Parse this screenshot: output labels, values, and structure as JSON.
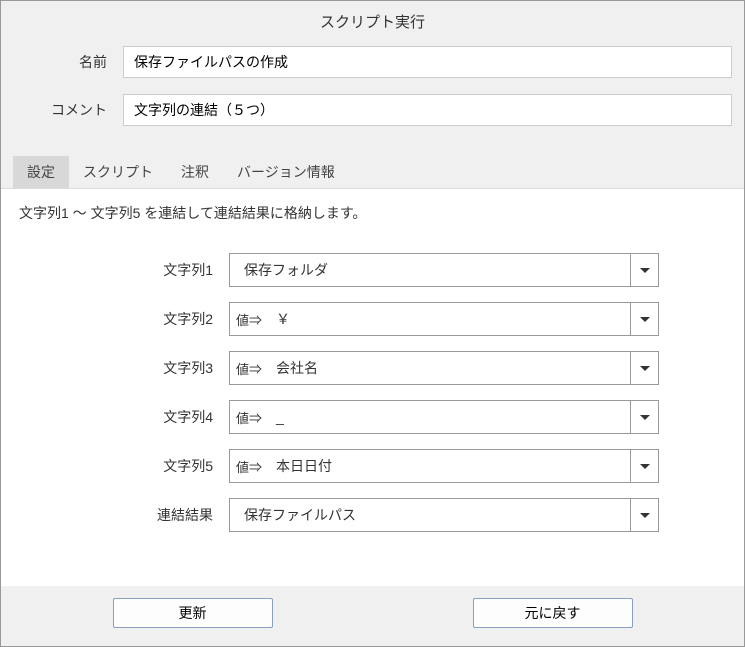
{
  "dialog": {
    "title": "スクリプト実行"
  },
  "header": {
    "name_label": "名前",
    "name_value": "保存ファイルパスの作成",
    "comment_label": "コメント",
    "comment_value": "文字列の連結（５つ）"
  },
  "tabs": {
    "settings": "設定",
    "script": "スクリプト",
    "annotation": "注釈",
    "version": "バージョン情報"
  },
  "settings_panel": {
    "description": "文字列1 ～ 文字列5 を連結して連結結果に格納します。",
    "params": [
      {
        "label": "文字列1",
        "prefix": "",
        "value": "保存フォルダ"
      },
      {
        "label": "文字列2",
        "prefix": "値⇒",
        "value": "￥"
      },
      {
        "label": "文字列3",
        "prefix": "値⇒",
        "value": "会社名"
      },
      {
        "label": "文字列4",
        "prefix": "値⇒",
        "value": "_"
      },
      {
        "label": "文字列5",
        "prefix": "値⇒",
        "value": "本日日付"
      },
      {
        "label": "連結結果",
        "prefix": "",
        "value": "保存ファイルパス"
      }
    ]
  },
  "buttons": {
    "update": "更新",
    "revert": "元に戻す"
  }
}
